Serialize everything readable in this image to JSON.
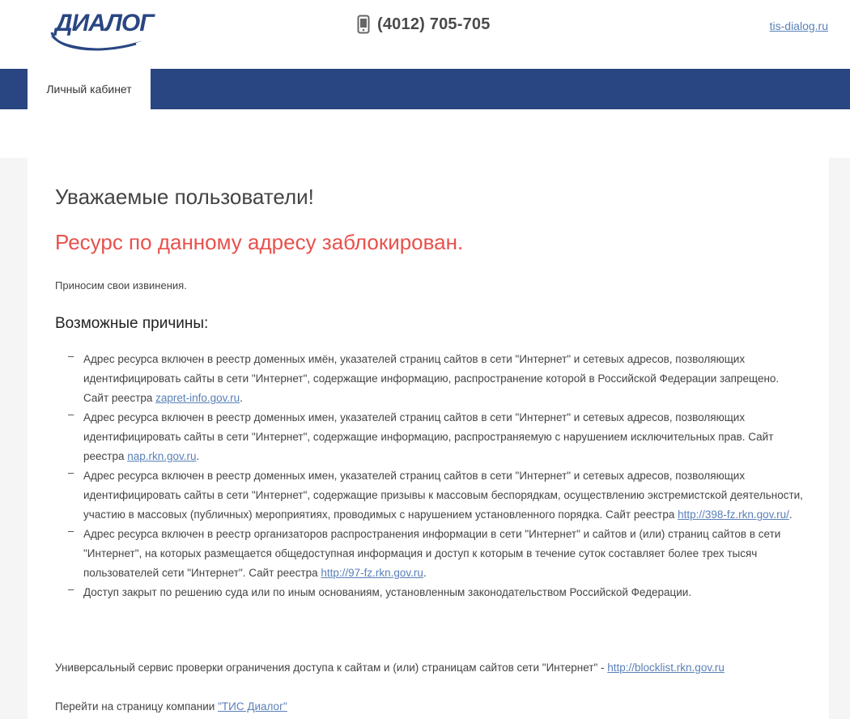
{
  "header": {
    "logo_text": "ДИАЛОГ",
    "phone_icon": "mobile-phone-icon",
    "phone": "(4012) 705-705",
    "site_link": "tis-dialog.ru"
  },
  "nav": {
    "tab_label": "Личный кабинет"
  },
  "main": {
    "greeting": "Уважаемые пользователи!",
    "blocked": "Ресурс по данному адресу заблокирован.",
    "apology": "Приносим свои извинения.",
    "reasons_title": "Возможные причины:",
    "reasons": [
      {
        "dash": "–",
        "text": "Адрес ресурса включен в реестр доменных имён, указателей страниц сайтов в сети \"Интернет\" и сетевых адресов, позволяющих идентифицировать сайты в сети \"Интернет\", содержащие информацию, распространение которой в Российской Федерации запрещено. Сайт реестра ",
        "link": "zapret-info.gov.ru",
        "after": "."
      },
      {
        "dash": "–",
        "text": "Адрес ресурса включен в реестр доменных имен, указателей страниц сайтов в сети \"Интернет\" и сетевых адресов, позволяющих идентифицировать сайты в сети \"Интернет\", содержащие информацию, распространяемую с нарушением исключительных прав. Сайт реестра ",
        "link": "nap.rkn.gov.ru",
        "after": "."
      },
      {
        "dash": "–",
        "text": "Адрес ресурса включен в реестр доменных имен, указателей страниц сайтов в сети \"Интернет\" и сетевых адресов, позволяющих идентифицировать сайты в сети \"Интернет\", содержащие призывы к массовым беспорядкам, осуществлению экстремистской деятельности, участию в массовых (публичных) мероприятиях, проводимых с нарушением установленного порядка. Сайт реестра ",
        "link": "http://398-fz.rkn.gov.ru/",
        "after": "."
      },
      {
        "dash": "–",
        "text": "Адрес ресурса включен в реестр организаторов распространения информации в сети \"Интернет\" и сайтов и (или) страниц сайтов в сети \"Интернет\", на которых размещается общедоступная информация и доступ к которым в течение суток составляет более трех тысяч пользователей сети \"Интернет\". Сайт реестра ",
        "link": "http://97-fz.rkn.gov.ru",
        "after": "."
      },
      {
        "dash": "–",
        "text": "Доступ закрыт по решению суда или по иным основаниям, установленным законодательством Российской Федерации.",
        "link": "",
        "after": ""
      }
    ],
    "service_text": "Универсальный сервис проверки ограничения доступа к сайтам и (или) страницам сайтов сети \"Интернет\" - ",
    "service_link": "http://blocklist.rkn.gov.ru",
    "company_text": "Перейти на страницу компании ",
    "company_link": "\"ТИС Диалог\""
  },
  "colors": {
    "navbar": "#294682",
    "logo": "#294682",
    "alert": "#e8514c",
    "link": "#5a80b8"
  }
}
